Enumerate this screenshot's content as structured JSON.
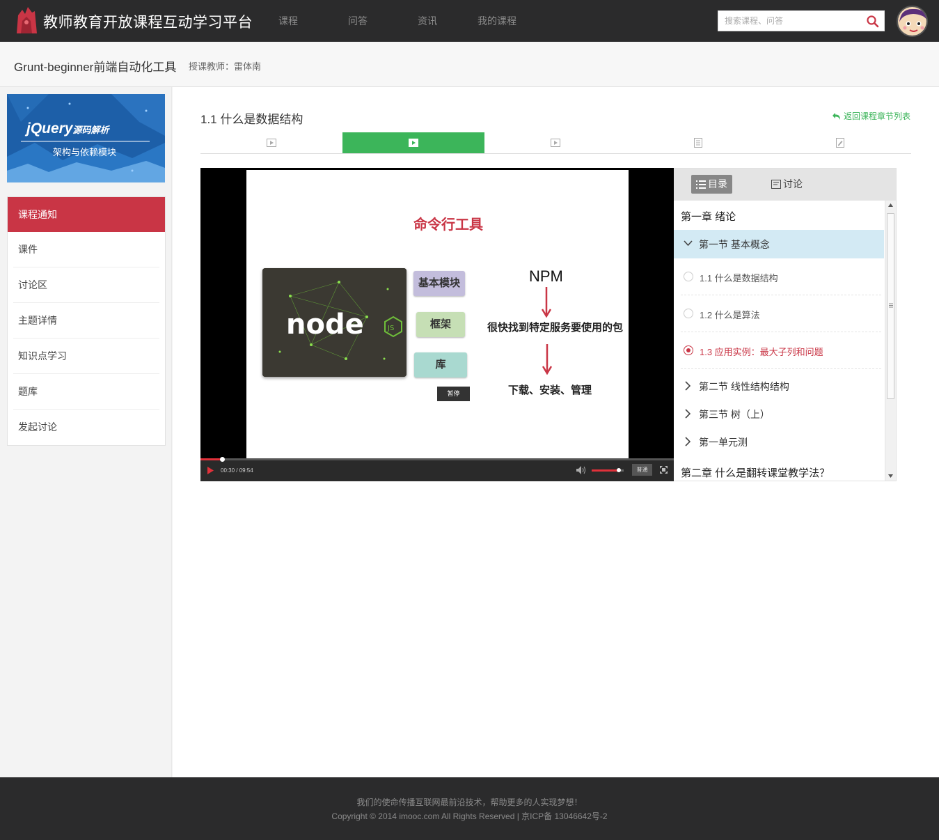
{
  "header": {
    "site_title": "教师教育开放课程互动学习平台",
    "nav": [
      "课程",
      "问答",
      "资讯",
      "我的课程"
    ],
    "search_placeholder": "搜索课程、问答"
  },
  "course": {
    "name": "Grunt-beginner前端自动化工具",
    "teacher": "授课教师：雷体南"
  },
  "banner": {
    "logo_text": "jQuery",
    "tagline": "源码解析",
    "subtitle": "架构与依赖模块"
  },
  "sidebar": {
    "items": [
      {
        "label": "课程通知",
        "active": true
      },
      {
        "label": "课件"
      },
      {
        "label": "讨论区"
      },
      {
        "label": "主题详情"
      },
      {
        "label": "知识点学习"
      },
      {
        "label": "题库"
      },
      {
        "label": "发起讨论"
      }
    ]
  },
  "lesson": {
    "title": "1.1 什么是数据结构",
    "back_link": "返回课程章节列表",
    "tab_icons": [
      "video-icon",
      "video-icon",
      "video-icon",
      "document-icon",
      "edit-icon"
    ],
    "active_tab": 1
  },
  "slide": {
    "title": "命令行工具",
    "boxes": [
      "基本模块",
      "框架",
      "库"
    ],
    "npm": "NPM",
    "text1": "很快找到特定服务要使用的包",
    "text2": "下载、安装、管理",
    "pause_tip": "暂停"
  },
  "player": {
    "time": "00:30 / 09:54",
    "progress": 0.045,
    "volume": 0.85,
    "quality": "普通"
  },
  "panel": {
    "tabs": [
      "目录",
      "讨论"
    ],
    "chapter1": "第一章 绪论",
    "section_open": "第一节 基本概念",
    "lessons": [
      {
        "label": "1.1 什么是数据结构"
      },
      {
        "label": "1.2 什么是算法"
      },
      {
        "label": "1.3 应用实例：最大子列和问题",
        "current": true
      }
    ],
    "sections": [
      "第二节 线性结构结构",
      "第三节 树（上）",
      "第一单元测"
    ],
    "chapter2": "第二章 什么是翻转课堂教学法？"
  },
  "footer": {
    "line1": "我们的使命传播互联网最前沿技术，帮助更多的人实现梦想！",
    "line2": "Copyright © 2014 imooc.com All Rights Reserved | 京ICP备 13046642号-2"
  },
  "colors": {
    "header_bg": "#2b2b2c",
    "accent_red": "#c93545",
    "accent_green": "#3cb55a",
    "panel_highlight": "#d3eaf4"
  }
}
